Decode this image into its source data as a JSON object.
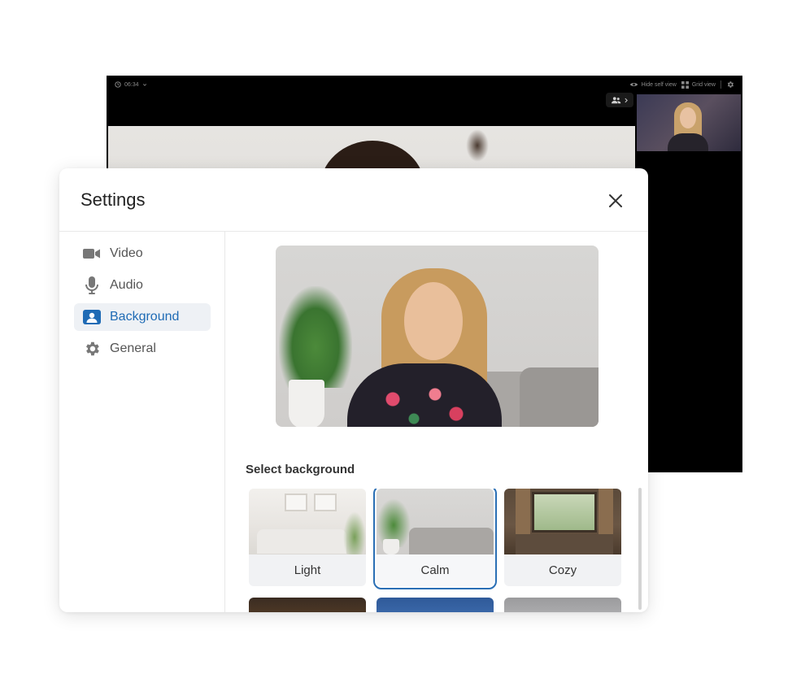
{
  "call": {
    "timer": "06:34",
    "hide_self_view": "Hide self view",
    "grid_view": "Grid view"
  },
  "settings": {
    "title": "Settings",
    "nav": [
      {
        "label": "Video",
        "icon": "video-camera-icon",
        "active": false
      },
      {
        "label": "Audio",
        "icon": "microphone-icon",
        "active": false
      },
      {
        "label": "Background",
        "icon": "background-portrait-icon",
        "active": true
      },
      {
        "label": "General",
        "icon": "gear-icon",
        "active": false
      }
    ],
    "section_label": "Select background",
    "backgrounds": [
      {
        "label": "Light",
        "selected": false
      },
      {
        "label": "Calm",
        "selected": true
      },
      {
        "label": "Cozy",
        "selected": false
      }
    ]
  },
  "colors": {
    "accent": "#1f6bb5",
    "selected_outline": "#2a6fb5",
    "active_nav_bg": "#eef1f5"
  }
}
